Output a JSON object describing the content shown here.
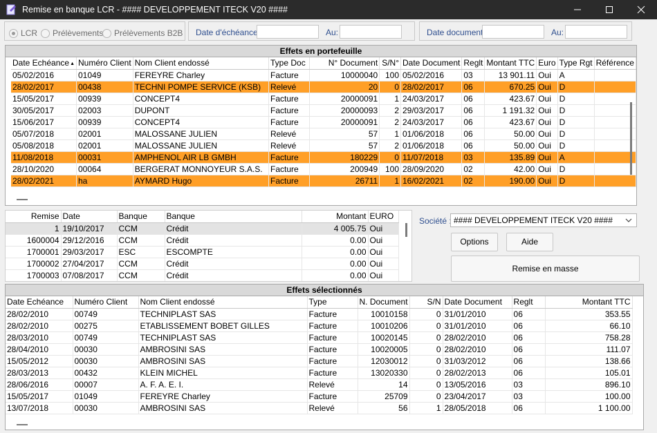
{
  "window": {
    "title": "Remise en banque LCR - #### DEVELOPPEMENT ITECK V20 ####"
  },
  "filters": {
    "types": [
      {
        "label": "LCR",
        "selected": true
      },
      {
        "label": "Prélèvements",
        "selected": false
      },
      {
        "label": "Prélèvements B2B",
        "selected": false
      }
    ],
    "echeance_label": "Date d'échéance:",
    "echeance_to_label": "Au:",
    "document_label": "Date document:",
    "document_to_label": "Au:"
  },
  "portefeuille": {
    "title": "Effets en portefeuille",
    "columns": [
      "Date Echéance",
      "Numéro Client",
      "Nom Client endossé",
      "Type Doc",
      "N° Document",
      "S/N°",
      "Date Document",
      "Reglt",
      "Montant TTC",
      "Euro",
      "Type Rgt",
      "Référence"
    ],
    "rows": [
      [
        "05/02/2016",
        "01049",
        "FEREYRE Charley",
        "Facture",
        "10000040",
        "100",
        "05/02/2016",
        "03",
        "13 901.11",
        "Oui",
        "A",
        ""
      ],
      [
        "28/02/2017",
        "00438",
        "TECHNI POMPE SERVICE (KSB)",
        "Relevé",
        "20",
        "0",
        "28/02/2017",
        "06",
        "670.25",
        "Oui",
        "D",
        ""
      ],
      [
        "15/05/2017",
        "00939",
        "CONCEPT4",
        "Facture",
        "20000091",
        "1",
        "24/03/2017",
        "06",
        "423.67",
        "Oui",
        "D",
        ""
      ],
      [
        "30/05/2017",
        "02003",
        "DUPONT",
        "Facture",
        "20000093",
        "2",
        "29/03/2017",
        "06",
        "1 191.32",
        "Oui",
        "D",
        ""
      ],
      [
        "15/06/2017",
        "00939",
        "CONCEPT4",
        "Facture",
        "20000091",
        "2",
        "24/03/2017",
        "06",
        "423.67",
        "Oui",
        "D",
        ""
      ],
      [
        "05/07/2018",
        "02001",
        "MALOSSANE JULIEN",
        "Relevé",
        "57",
        "1",
        "01/06/2018",
        "06",
        "50.00",
        "Oui",
        "D",
        ""
      ],
      [
        "05/08/2018",
        "02001",
        "MALOSSANE JULIEN",
        "Relevé",
        "57",
        "2",
        "01/06/2018",
        "06",
        "50.00",
        "Oui",
        "D",
        ""
      ],
      [
        "11/08/2018",
        "00031",
        "AMPHENOL AIR LB GMBH",
        "Facture",
        "180229",
        "0",
        "11/07/2018",
        "03",
        "135.89",
        "Oui",
        "A",
        ""
      ],
      [
        "28/10/2020",
        "00064",
        "BERGERAT MONNOYEUR S.A.S.",
        "Facture",
        "200949",
        "100",
        "28/09/2020",
        "02",
        "42.00",
        "Oui",
        "D",
        ""
      ],
      [
        "28/02/2021",
        "ha",
        "AYMARD Hugo",
        "Facture",
        "26711",
        "1",
        "16/02/2021",
        "02",
        "190.00",
        "Oui",
        "D",
        ""
      ]
    ],
    "highlighted": [
      1,
      7,
      9
    ]
  },
  "remises": {
    "columns": [
      "Remise",
      "Date",
      "Banque",
      "Banque",
      "Montant",
      "EURO"
    ],
    "rows": [
      [
        "1",
        "19/10/2017",
        "CCM",
        "Crédit",
        "4 005.75",
        "Oui"
      ],
      [
        "1600004",
        "29/12/2016",
        "CCM",
        "Crédit",
        "0.00",
        "Oui"
      ],
      [
        "1700001",
        "29/03/2017",
        "ESC",
        "ESCOMPTE",
        "0.00",
        "Oui"
      ],
      [
        "1700002",
        "27/04/2017",
        "CCM",
        "Crédit",
        "0.00",
        "Oui"
      ],
      [
        "1700003",
        "07/08/2017",
        "CCM",
        "Crédit",
        "0.00",
        "Oui"
      ]
    ]
  },
  "societe": {
    "label": "Société :",
    "value": "#### DEVELOPPEMENT ITECK V20 ####"
  },
  "buttons": {
    "options": "Options",
    "aide": "Aide",
    "remise_masse": "Remise en masse"
  },
  "selectionnes": {
    "title": "Effets sélectionnés",
    "columns": [
      "Date Echéance",
      "Numéro Client",
      "Nom Client endossé",
      "Type",
      "N.  Document",
      "S/N",
      "Date Document",
      "Reglt",
      "Montant TTC"
    ],
    "rows": [
      [
        "28/02/2010",
        "00749",
        "TECHNIPLAST SAS",
        "Facture",
        "10010158",
        "0",
        "31/01/2010",
        "06",
        "353.55"
      ],
      [
        "28/02/2010",
        "00275",
        "ETABLISSEMENT BOBET GILLES",
        "Facture",
        "10010206",
        "0",
        "31/01/2010",
        "06",
        "66.10"
      ],
      [
        "28/03/2010",
        "00749",
        "TECHNIPLAST SAS",
        "Facture",
        "10020145",
        "0",
        "28/02/2010",
        "06",
        "758.28"
      ],
      [
        "28/04/2010",
        "00030",
        "AMBROSINI SAS",
        "Facture",
        "10020005",
        "0",
        "28/02/2010",
        "06",
        "111.07"
      ],
      [
        "15/05/2012",
        "00030",
        "AMBROSINI SAS",
        "Facture",
        "12030012",
        "0",
        "31/03/2012",
        "06",
        "138.66"
      ],
      [
        "28/03/2013",
        "00432",
        "KLEIN MICHEL",
        "Facture",
        "13020330",
        "0",
        "28/02/2013",
        "06",
        "105.01"
      ],
      [
        "28/06/2016",
        "00007",
        "A. F. A. E. I.",
        "Relevé",
        "14",
        "0",
        "13/05/2016",
        "03",
        "896.10"
      ],
      [
        "15/05/2017",
        "01049",
        "FEREYRE Charley",
        "Facture",
        "25709",
        "0",
        "23/04/2017",
        "03",
        "100.00"
      ],
      [
        "13/07/2018",
        "00030",
        "AMBROSINI SAS",
        "Relevé",
        "56",
        "1",
        "28/05/2018",
        "06",
        "1 100.00"
      ]
    ]
  }
}
